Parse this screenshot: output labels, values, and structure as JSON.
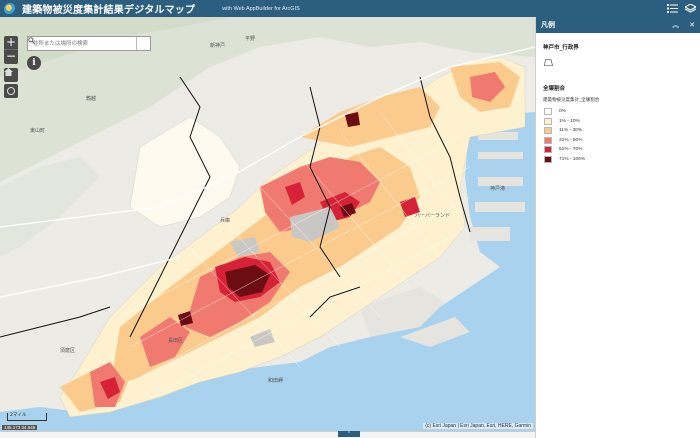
{
  "header": {
    "title": "建築物被災度集計結果デジタルマップ",
    "subtitle": "with Web AppBuilder for ArcGIS"
  },
  "search": {
    "placeholder": "住所または場所の検索"
  },
  "map": {
    "attribution": "(c) Esri Japan | Esri Japan, Esri, HERE, Garmin",
    "coordinates": "135.173 34.646",
    "scale_label": "2マイル",
    "place_labels": {
      "hiyodori": "鵯越",
      "hirano": "平野",
      "higashiyama": "東山町",
      "hyogo_station": "兵庫",
      "kobe_port": "神戸港",
      "wadamisaki": "和田岬",
      "nagata": "長田区",
      "suma": "須磨区",
      "shin_kobe": "新神戸",
      "harborland": "ハーバーランド"
    }
  },
  "legend": {
    "panel_title": "凡例",
    "layer_boundary": "神戸市_行政界",
    "layer_group": "全壊割合",
    "field_label": "建築物被災度集計_全壊割合",
    "items": [
      {
        "label": "0%",
        "color": "#ffffff"
      },
      {
        "label": "1% - 10%",
        "color": "#fdf1cf"
      },
      {
        "label": "11% - 30%",
        "color": "#fbcb8e"
      },
      {
        "label": "31% - 50%",
        "color": "#f07a70"
      },
      {
        "label": "51% - 70%",
        "color": "#d62236"
      },
      {
        "label": "71% - 100%",
        "color": "#6b0d12"
      }
    ]
  },
  "colors": {
    "header": "#2c5f7f",
    "sea": "#a8d2ee",
    "land": "#ecebe5"
  }
}
